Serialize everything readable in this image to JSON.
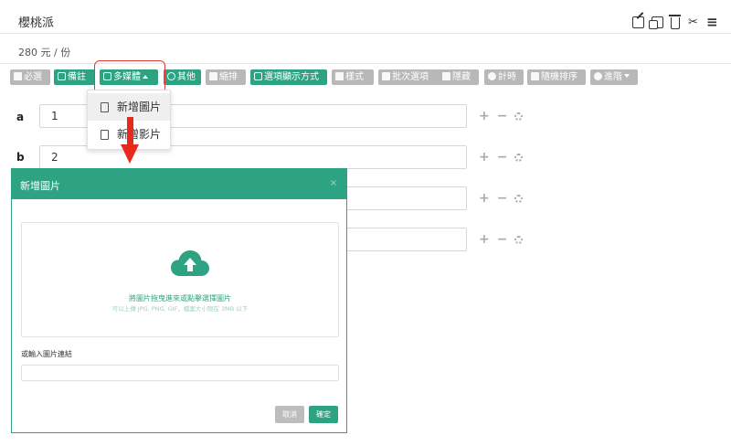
{
  "question": {
    "title": "櫻桃派",
    "price": "280 元 / 份"
  },
  "header_icons": [
    "edit-icon",
    "copy-icon",
    "trash-icon",
    "scissors-icon",
    "menu-icon"
  ],
  "toolbar": {
    "required": "必選",
    "note": "備註",
    "media": "多媒體",
    "other": "其他",
    "indent": "縮排",
    "display_mode": "選項顯示方式",
    "style": "樣式",
    "batch": "批次選項",
    "hide": "隱藏",
    "timer": "計時",
    "shuffle": "隨機排序",
    "advanced": "進階"
  },
  "media_menu": {
    "add_image": "新增圖片",
    "add_video": "新增影片"
  },
  "options": [
    {
      "label": "a",
      "value": "1"
    },
    {
      "label": "b",
      "value": "2"
    },
    {
      "label": "",
      "value": ""
    },
    {
      "label": "",
      "value": ""
    }
  ],
  "modal": {
    "title": "新增圖片",
    "close": "×",
    "dropzone_main": "將圖片拖曳進來或點擊選擇圖片",
    "dropzone_sub": "可以上傳 JPG, PNG, GIF，檔案大小限在 3MB 以下",
    "url_label": "或輸入圖片連結",
    "url_value": "",
    "cancel": "取消",
    "confirm": "確定"
  },
  "colors": {
    "accent": "#2ea383",
    "disabled": "#b8b8b8",
    "annotation": "#e8291c"
  }
}
